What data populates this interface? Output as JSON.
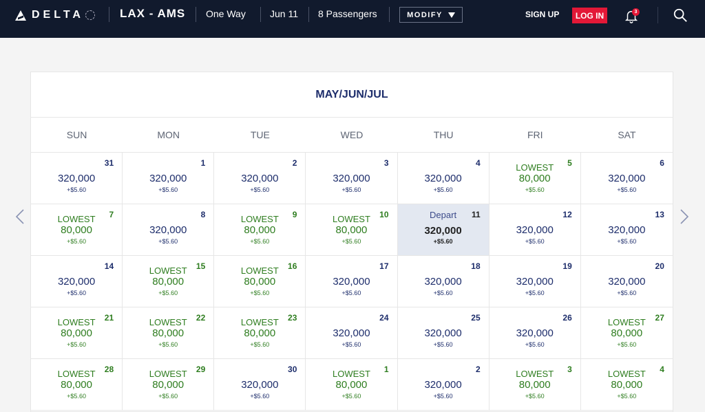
{
  "header": {
    "brand": "DELTA",
    "route": "LAX - AMS",
    "trip_type": "One Way",
    "date": "Jun 11",
    "passengers": "8 Passengers",
    "modify_label": "MODIFY",
    "signup_label": "SIGN UP",
    "login_label": "LOG IN",
    "notification_count": "3",
    "colors": {
      "bar": "#111a2d",
      "login": "#e31837"
    }
  },
  "calendar": {
    "title": "MAY/JUN/JUL",
    "weekdays": [
      "SUN",
      "MON",
      "TUE",
      "WED",
      "THU",
      "FRI",
      "SAT"
    ],
    "lowest_label": "LOWEST",
    "depart_label": "Depart",
    "colors": {
      "regular": "#1d2d6b",
      "lowest": "#2e7d1f",
      "selected_bg": "#e3e8f1"
    },
    "days": [
      {
        "day": "31",
        "price": "320,000",
        "fee": "+$5.60",
        "lowest": false
      },
      {
        "day": "1",
        "price": "320,000",
        "fee": "+$5.60",
        "lowest": false
      },
      {
        "day": "2",
        "price": "320,000",
        "fee": "+$5.60",
        "lowest": false
      },
      {
        "day": "3",
        "price": "320,000",
        "fee": "+$5.60",
        "lowest": false
      },
      {
        "day": "4",
        "price": "320,000",
        "fee": "+$5.60",
        "lowest": false
      },
      {
        "day": "5",
        "price": "80,000",
        "fee": "+$5.60",
        "lowest": true
      },
      {
        "day": "6",
        "price": "320,000",
        "fee": "+$5.60",
        "lowest": false
      },
      {
        "day": "7",
        "price": "80,000",
        "fee": "+$5.60",
        "lowest": true
      },
      {
        "day": "8",
        "price": "320,000",
        "fee": "+$5.60",
        "lowest": false
      },
      {
        "day": "9",
        "price": "80,000",
        "fee": "+$5.60",
        "lowest": true
      },
      {
        "day": "10",
        "price": "80,000",
        "fee": "+$5.60",
        "lowest": true
      },
      {
        "day": "11",
        "price": "320,000",
        "fee": "+$5.60",
        "lowest": false,
        "selected": true
      },
      {
        "day": "12",
        "price": "320,000",
        "fee": "+$5.60",
        "lowest": false
      },
      {
        "day": "13",
        "price": "320,000",
        "fee": "+$5.60",
        "lowest": false
      },
      {
        "day": "14",
        "price": "320,000",
        "fee": "+$5.60",
        "lowest": false
      },
      {
        "day": "15",
        "price": "80,000",
        "fee": "+$5.60",
        "lowest": true
      },
      {
        "day": "16",
        "price": "80,000",
        "fee": "+$5.60",
        "lowest": true
      },
      {
        "day": "17",
        "price": "320,000",
        "fee": "+$5.60",
        "lowest": false
      },
      {
        "day": "18",
        "price": "320,000",
        "fee": "+$5.60",
        "lowest": false
      },
      {
        "day": "19",
        "price": "320,000",
        "fee": "+$5.60",
        "lowest": false
      },
      {
        "day": "20",
        "price": "320,000",
        "fee": "+$5.60",
        "lowest": false
      },
      {
        "day": "21",
        "price": "80,000",
        "fee": "+$5.60",
        "lowest": true
      },
      {
        "day": "22",
        "price": "80,000",
        "fee": "+$5.60",
        "lowest": true
      },
      {
        "day": "23",
        "price": "80,000",
        "fee": "+$5.60",
        "lowest": true
      },
      {
        "day": "24",
        "price": "320,000",
        "fee": "+$5.60",
        "lowest": false
      },
      {
        "day": "25",
        "price": "320,000",
        "fee": "+$5.60",
        "lowest": false
      },
      {
        "day": "26",
        "price": "320,000",
        "fee": "+$5.60",
        "lowest": false
      },
      {
        "day": "27",
        "price": "80,000",
        "fee": "+$5.60",
        "lowest": true
      },
      {
        "day": "28",
        "price": "80,000",
        "fee": "+$5.60",
        "lowest": true
      },
      {
        "day": "29",
        "price": "80,000",
        "fee": "+$5.60",
        "lowest": true
      },
      {
        "day": "30",
        "price": "320,000",
        "fee": "+$5.60",
        "lowest": false
      },
      {
        "day": "1",
        "price": "80,000",
        "fee": "+$5.60",
        "lowest": true
      },
      {
        "day": "2",
        "price": "320,000",
        "fee": "+$5.60",
        "lowest": false
      },
      {
        "day": "3",
        "price": "80,000",
        "fee": "+$5.60",
        "lowest": true
      },
      {
        "day": "4",
        "price": "80,000",
        "fee": "+$5.60",
        "lowest": true
      }
    ]
  },
  "icons": {
    "logo": "delta-widget-icon",
    "modify_caret": "caret-down-icon",
    "notifications": "bell-icon",
    "search": "search-icon",
    "prev": "chevron-left-icon",
    "next": "chevron-right-icon"
  }
}
